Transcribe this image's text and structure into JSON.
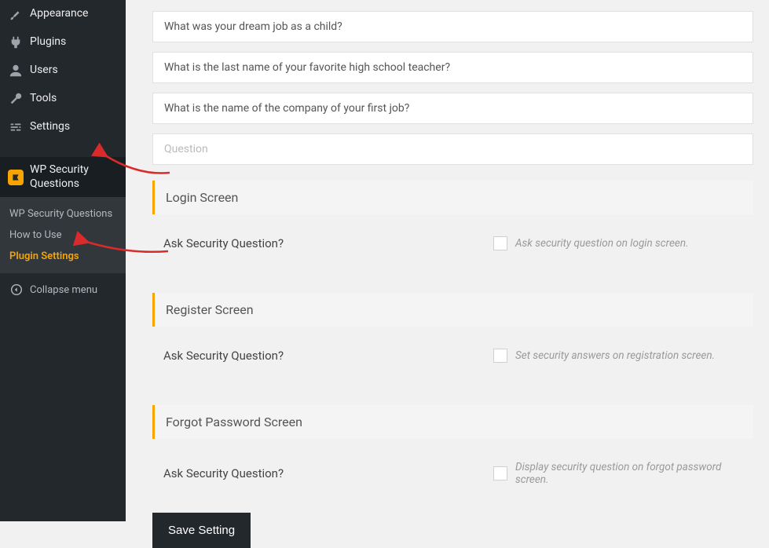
{
  "sidebar": {
    "items": [
      {
        "label": "Appearance"
      },
      {
        "label": "Plugins"
      },
      {
        "label": "Users"
      },
      {
        "label": "Tools"
      },
      {
        "label": "Settings"
      },
      {
        "label": "WP Security Questions"
      }
    ],
    "submenu": [
      {
        "label": "WP Security Questions"
      },
      {
        "label": "How to Use"
      },
      {
        "label": "Plugin Settings"
      }
    ],
    "collapse": "Collapse menu"
  },
  "questions": [
    "What was your dream job as a child?",
    "What is the last name of your favorite high school teacher?",
    "What is the name of the company of your first job?"
  ],
  "question_placeholder": "Question",
  "sections": {
    "login": {
      "title": "Login Screen",
      "setting_label": "Ask Security Question?",
      "desc": "Ask security question on login screen."
    },
    "register": {
      "title": "Register Screen",
      "setting_label": "Ask Security Question?",
      "desc": "Set security answers on registration screen."
    },
    "forgot": {
      "title": "Forgot Password Screen",
      "setting_label": "Ask Security Question?",
      "desc": "Display security question on forgot password screen."
    }
  },
  "save_button": "Save Setting"
}
